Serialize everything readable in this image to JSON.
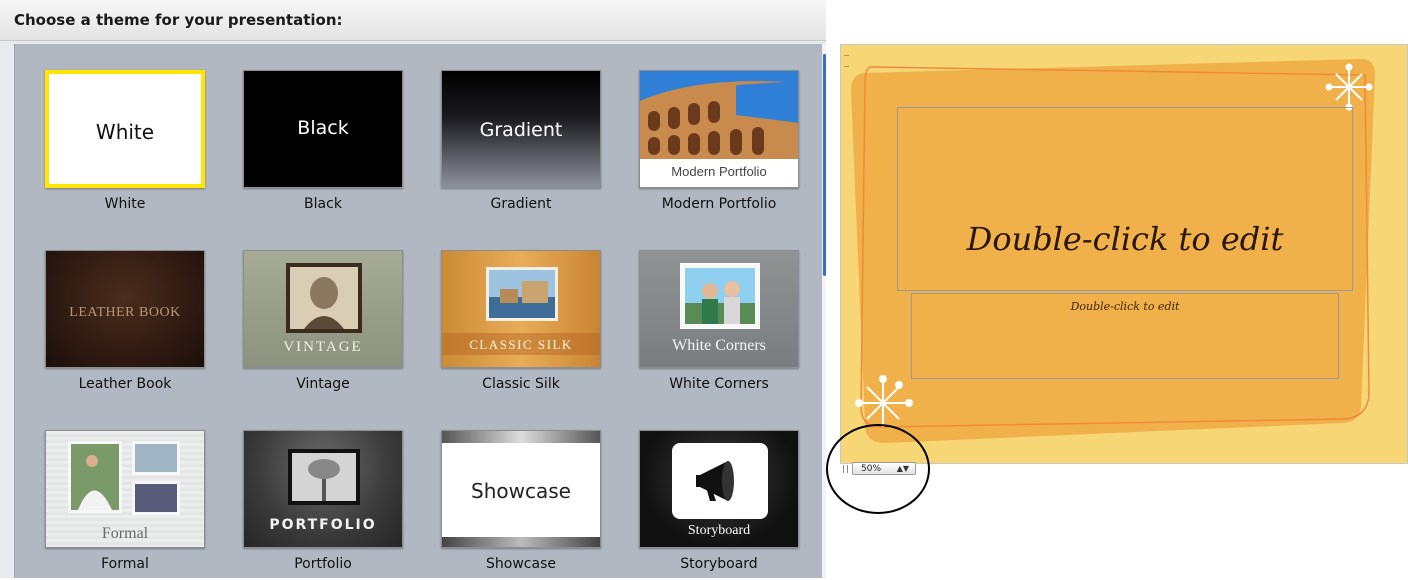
{
  "chooser": {
    "title": "Choose a theme for your presentation:",
    "themes": [
      {
        "name": "White",
        "thumb_label": "White",
        "selected": true
      },
      {
        "name": "Black",
        "thumb_label": "Black"
      },
      {
        "name": "Gradient",
        "thumb_label": "Gradient"
      },
      {
        "name": "Modern Portfolio",
        "thumb_label": "Modern Portfolio"
      },
      {
        "name": "Leather Book",
        "thumb_label": "LEATHER BOOK"
      },
      {
        "name": "Vintage",
        "thumb_label": "VINTAGE"
      },
      {
        "name": "Classic Silk",
        "thumb_label": "CLASSIC SILK"
      },
      {
        "name": "White Corners",
        "thumb_label": "White Corners"
      },
      {
        "name": "Formal",
        "thumb_label": "Formal"
      },
      {
        "name": "Portfolio",
        "thumb_label": "PORTFOLIO"
      },
      {
        "name": "Showcase",
        "thumb_label": "Showcase"
      },
      {
        "name": "Storyboard",
        "thumb_label": "Storyboard"
      }
    ]
  },
  "slide": {
    "title_placeholder": "Double-click to edit",
    "subtitle_placeholder": "Double-click to edit"
  },
  "zoom": {
    "value": "50%",
    "arrows": "▲▼"
  },
  "colors": {
    "selection": "#ffe600",
    "slide_background": "#f6d675",
    "slide_shape": "#f0b14a",
    "scroll_thumb": "#2f6fd0",
    "panel_background": "#b2b8c1"
  }
}
